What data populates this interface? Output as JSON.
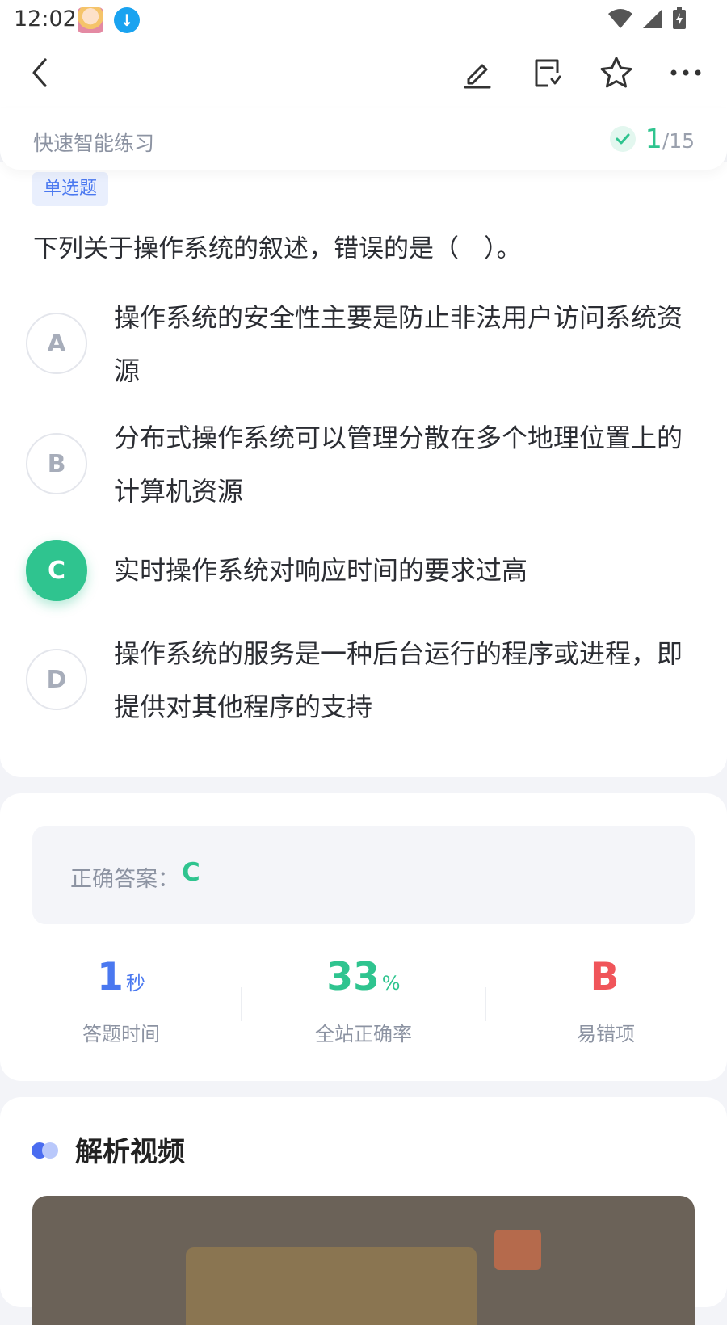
{
  "status_bar": {
    "time": "12:02"
  },
  "toolbar": {
    "back_icon": "chevron-left-icon",
    "edit_icon": "pencil-icon",
    "note_icon": "note-icon",
    "favorite_icon": "star-icon",
    "more_icon": "more-horizontal-icon"
  },
  "subheader": {
    "title": "快速智能练习",
    "progress_current": "1",
    "progress_total": "/15"
  },
  "question": {
    "type": "单选题",
    "text": "下列关于操作系统的叙述，错误的是（　）。",
    "options": [
      {
        "letter": "A",
        "text": "操作系统的安全性主要是防止非法用户访问系统资源"
      },
      {
        "letter": "B",
        "text": "分布式操作系统可以管理分散在多个地理位置上的计算机资源"
      },
      {
        "letter": "C",
        "text": "实时操作系统对响应时间的要求过高"
      },
      {
        "letter": "D",
        "text": "操作系统的服务是一种后台运行的程序或进程，即提供对其他程序的支持"
      }
    ],
    "selected": "C"
  },
  "answer": {
    "label": "正确答案：",
    "value": "C"
  },
  "stats": [
    {
      "value": "1",
      "unit": "秒",
      "label": "答题时间",
      "color": "#4a78f0"
    },
    {
      "value": "33",
      "unit": "%",
      "label": "全站正确率",
      "color": "#2fc48f"
    },
    {
      "value": "B",
      "unit": "",
      "label": "易错项",
      "color": "#f0555a"
    }
  ],
  "video_section": {
    "title": "解析视频"
  },
  "colors": {
    "accent_green": "#2fc48f",
    "accent_blue": "#4a78f0",
    "error_red": "#f0555a"
  }
}
